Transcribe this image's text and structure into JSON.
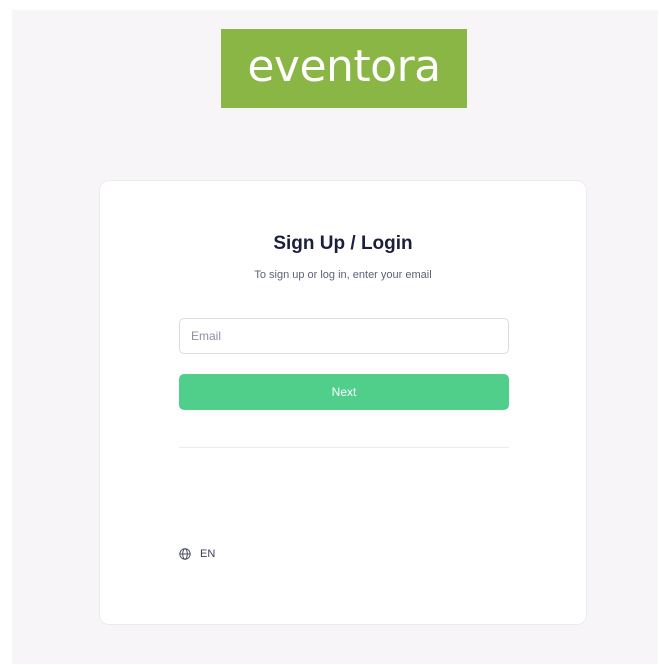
{
  "brand": {
    "logo_text": "eventora",
    "logo_color": "#8ab645"
  },
  "auth": {
    "title": "Sign Up / Login",
    "subtitle": "To sign up or log in, enter your email",
    "email": {
      "placeholder": "Email",
      "value": ""
    },
    "next_label": "Next",
    "accent_color": "#50cf8a"
  },
  "language": {
    "icon": "globe-icon",
    "label": "EN"
  }
}
